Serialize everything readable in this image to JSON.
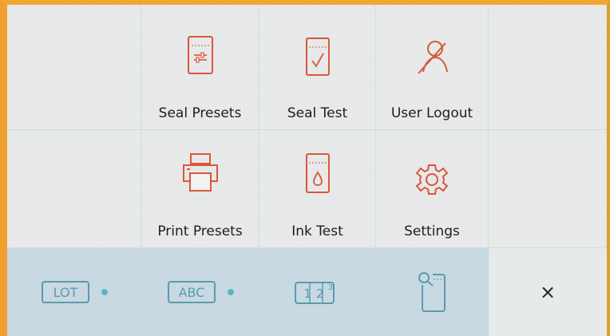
{
  "tiles": [
    {
      "label": "Seal Presets",
      "icon": "sliders-document-icon"
    },
    {
      "label": "Seal Test",
      "icon": "checkmark-document-icon"
    },
    {
      "label": "User Logout",
      "icon": "user-logout-icon"
    },
    {
      "label": "Print Presets",
      "icon": "printer-icon"
    },
    {
      "label": "Ink Test",
      "icon": "ink-drop-document-icon"
    },
    {
      "label": "Settings",
      "icon": "gear-icon"
    }
  ],
  "bottom_bar": {
    "lot_label": "LOT",
    "abc_label": "ABC",
    "numbers_label": "12",
    "numbers_superscript": "3",
    "close_label": "×"
  },
  "colors": {
    "accent": "#d9573a",
    "bottom_icon": "#5c9ab0",
    "status_dot": "#56b8be",
    "bezel": "#f0a030"
  }
}
